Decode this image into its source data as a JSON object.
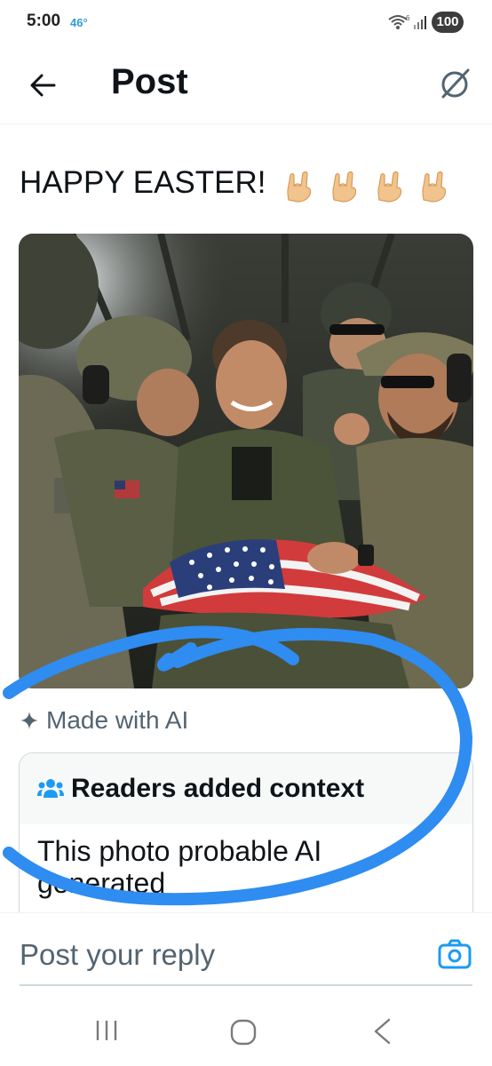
{
  "status_bar": {
    "time": "5:00",
    "temperature": "46°",
    "battery": "100",
    "wifi_label": "6"
  },
  "header": {
    "title": "Post",
    "back_icon": "arrow-left-icon",
    "grok_icon": "grok-icon"
  },
  "post": {
    "text": "HAPPY EASTER!",
    "emoji": [
      "rock-on-hand-emoji",
      "rock-on-hand-emoji",
      "rock-on-hand-emoji",
      "rock-on-hand-emoji"
    ],
    "media_alt": "Soldiers in a helicopter smiling around an American flag",
    "ai_label": "Made with AI"
  },
  "community_note": {
    "title": "Readers added context",
    "body": "This photo probable AI generated"
  },
  "reply": {
    "placeholder": "Post your reply",
    "camera_icon": "camera-icon"
  },
  "colors": {
    "text_primary": "#0f1419",
    "text_secondary": "#536471",
    "accent": "#1d9bf0",
    "annotation": "#2f8cf0",
    "note_header_bg": "#f7f9f9"
  }
}
